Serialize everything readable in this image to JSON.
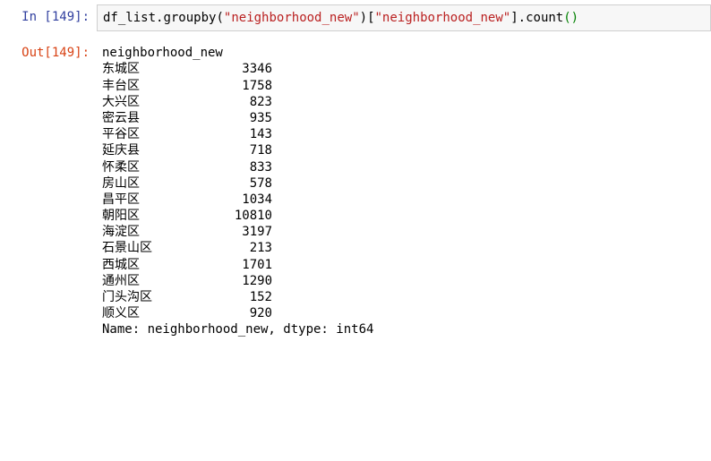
{
  "input": {
    "prompt": "In [149]:",
    "code_parts": {
      "p1": "df_list",
      "p2": ".",
      "p3": "groupby",
      "p4": "(",
      "p5": "\"neighborhood_new\"",
      "p6": ")",
      "p7": "[",
      "p8": "\"neighborhood_new\"",
      "p9": "]",
      "p10": ".",
      "p11": "count",
      "p12": "()"
    }
  },
  "output": {
    "prompt": "Out[149]:",
    "header": "neighborhood_new",
    "rows": [
      {
        "label": "东城区",
        "value": "3346"
      },
      {
        "label": "丰台区",
        "value": "1758"
      },
      {
        "label": "大兴区",
        "value": "823"
      },
      {
        "label": "密云县",
        "value": "935"
      },
      {
        "label": "平谷区",
        "value": "143"
      },
      {
        "label": "延庆县",
        "value": "718"
      },
      {
        "label": "怀柔区",
        "value": "833"
      },
      {
        "label": "房山区",
        "value": "578"
      },
      {
        "label": "昌平区",
        "value": "1034"
      },
      {
        "label": "朝阳区",
        "value": "10810"
      },
      {
        "label": "海淀区",
        "value": "3197"
      },
      {
        "label": "石景山区",
        "value": "213"
      },
      {
        "label": "西城区",
        "value": "1701"
      },
      {
        "label": "通州区",
        "value": "1290"
      },
      {
        "label": "门头沟区",
        "value": "152"
      },
      {
        "label": "顺义区",
        "value": "920"
      }
    ],
    "footer": "Name: neighborhood_new, dtype: int64"
  },
  "chart_data": {
    "type": "table",
    "title": "neighborhood_new",
    "columns": [
      "neighborhood_new",
      "count"
    ],
    "rows": [
      [
        "东城区",
        3346
      ],
      [
        "丰台区",
        1758
      ],
      [
        "大兴区",
        823
      ],
      [
        "密云县",
        935
      ],
      [
        "平谷区",
        143
      ],
      [
        "延庆县",
        718
      ],
      [
        "怀柔区",
        833
      ],
      [
        "房山区",
        578
      ],
      [
        "昌平区",
        1034
      ],
      [
        "朝阳区",
        10810
      ],
      [
        "海淀区",
        3197
      ],
      [
        "石景山区",
        213
      ],
      [
        "西城区",
        1701
      ],
      [
        "通州区",
        1290
      ],
      [
        "门头沟区",
        152
      ],
      [
        "顺义区",
        920
      ]
    ],
    "dtype": "int64"
  }
}
